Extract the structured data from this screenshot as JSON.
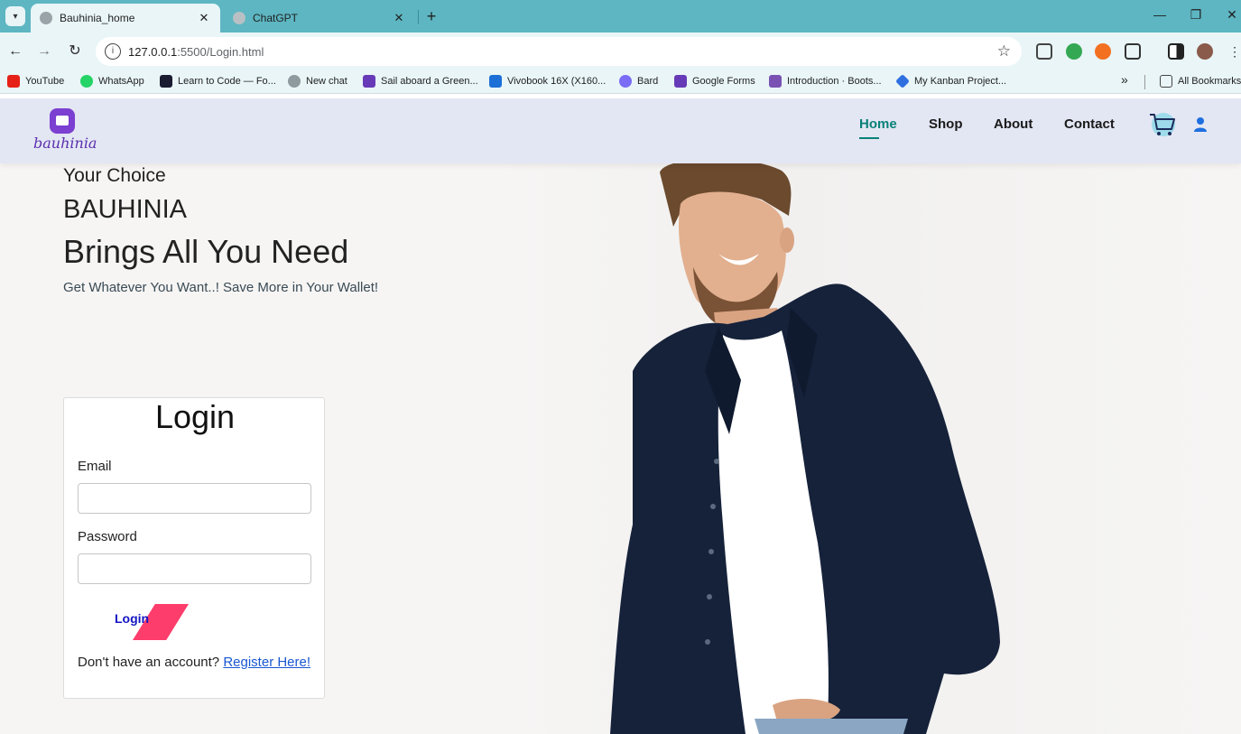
{
  "browser": {
    "tabs": [
      {
        "title": "Bauhinia_home",
        "active": true
      },
      {
        "title": "ChatGPT",
        "active": false
      }
    ],
    "close_glyph": "✕",
    "new_tab_glyph": "+",
    "url_host": "127.0.0.1",
    "url_path": ":5500/Login.html",
    "bookmarks": [
      {
        "label": "YouTube",
        "icon": "youtube-icon",
        "color": "#e62117"
      },
      {
        "label": "WhatsApp",
        "icon": "whatsapp-icon",
        "color": "#25d366"
      },
      {
        "label": "Learn to Code — Fo...",
        "icon": "freecodecamp-icon",
        "color": "#1b1b32"
      },
      {
        "label": "New chat",
        "icon": "chatgpt-icon",
        "color": "#8e9a9d"
      },
      {
        "label": "Sail aboard a Green...",
        "icon": "forms-icon",
        "color": "#673ab7"
      },
      {
        "label": "Vivobook 16X (X160...",
        "icon": "asus-icon",
        "color": "#1c6fd6"
      },
      {
        "label": "Bard",
        "icon": "bard-icon",
        "color": "#7b6cf6"
      },
      {
        "label": "Google Forms",
        "icon": "google-forms-icon",
        "color": "#673ab7"
      },
      {
        "label": "Introduction · Boots...",
        "icon": "bootstrap-icon",
        "color": "#7952b3"
      },
      {
        "label": "My Kanban Project...",
        "icon": "kanban-icon",
        "color": "#2f6fe0"
      }
    ],
    "more_glyph": "»",
    "all_bookmarks": "All Bookmarks"
  },
  "site": {
    "logo_text": "bauhinia",
    "nav": [
      "Home",
      "Shop",
      "About",
      "Contact"
    ],
    "active_nav": "Home",
    "colors": {
      "accent": "#088178",
      "header_bg": "#e3e6f3",
      "login_button": "#fd3d6b"
    }
  },
  "hero": {
    "line1": "Your Choice",
    "line2": "BAUHINIA",
    "line3": "Brings All You Need",
    "tagline": "Get Whatever You Want..! Save More in Your Wallet!"
  },
  "login": {
    "title": "Login",
    "email_label": "Email",
    "email_value": "",
    "password_label": "Password",
    "password_value": "",
    "button_label": "Login",
    "register_prompt": "Don't have an account?",
    "register_link": "Register Here!"
  }
}
